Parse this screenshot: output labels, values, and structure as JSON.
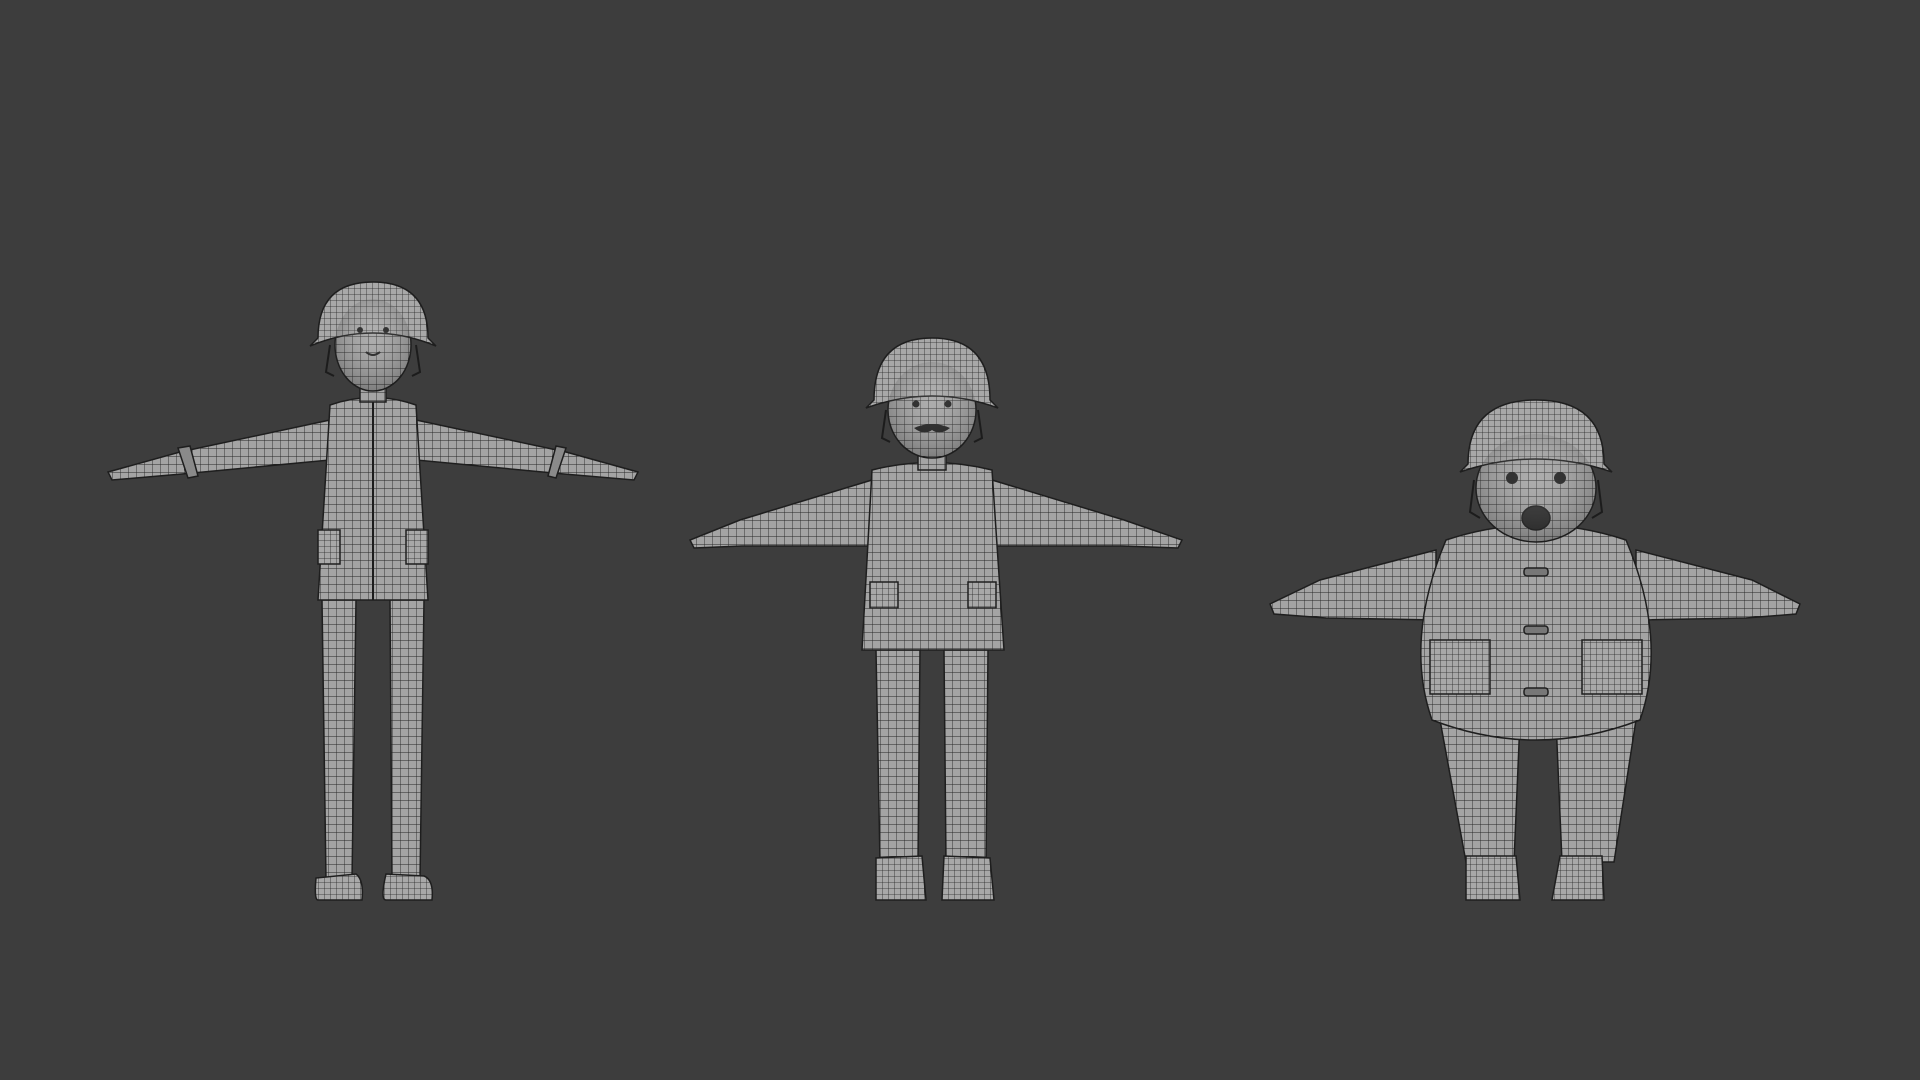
{
  "scene": {
    "background_color": "#3d3d3d",
    "mesh_fill_color": "#9a9a9a",
    "mesh_shade_color": "#7c7c7c",
    "wire_color": "#2a2a2a",
    "outline_color": "#1c1c1c",
    "characters": [
      {
        "name": "tall-thin-character",
        "build": "tall-thin"
      },
      {
        "name": "medium-character",
        "build": "medium"
      },
      {
        "name": "heavy-character",
        "build": "heavy"
      }
    ]
  }
}
